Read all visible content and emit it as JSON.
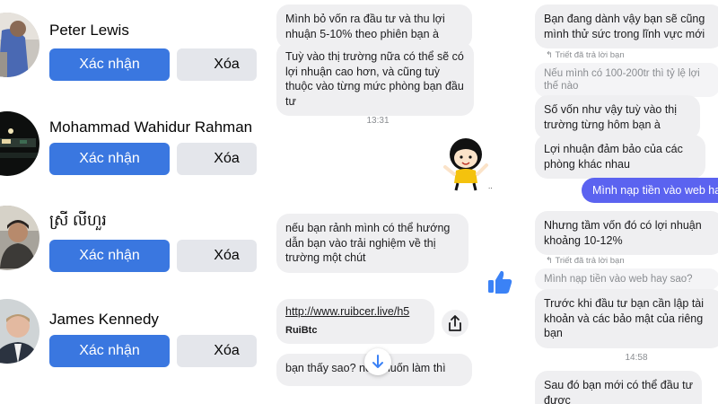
{
  "friend_requests": [
    {
      "name": "Peter Lewis",
      "confirm_label": "Xác nhận",
      "delete_label": "Xóa"
    },
    {
      "name": "Mohammad Wahidur Rahman",
      "confirm_label": "Xác nhận",
      "delete_label": "Xóa"
    },
    {
      "name": "ស្រី លីហួរ",
      "confirm_label": "Xác nhận",
      "delete_label": "Xóa"
    },
    {
      "name": "James Kennedy",
      "confirm_label": "Xác nhận",
      "delete_label": "Xóa"
    }
  ],
  "chat1": {
    "messages": [
      "Mình bỏ vốn ra đầu tư và thu lợi nhuận 5-10% theo phiên bạn à",
      "Tuỳ vào thị trường nữa có thể sẽ có lợi nhuận cao hơn, và cũng tuỳ thuộc vào từng mức phòng bạn đầu tư",
      "nếu bạn rảnh mình có thể hướng dẫn bạn vào trải nghiệm về thị trường một chút",
      "bạn thấy sao? nếu muốn làm thì"
    ],
    "timestamp": "13:31",
    "link": {
      "url": "http://www.ruibcer.live/h5",
      "site_name": "RuiBtc"
    }
  },
  "chat2": {
    "messages_top": [
      "Bạn đang dành vậy bạn sẽ cũng mình thử sức trong lĩnh vực mới"
    ],
    "reply_tag": "Triết đã trả lời bạn",
    "quoted_1": "Nếu mình có 100-200tr thì tỷ lệ lợi thế nào",
    "messages_mid": [
      "Số vốn như vậy tuỳ vào thị trường từng hôm bạn à",
      "Lợi nhuận đảm bảo của các phòng khác nhau"
    ],
    "outgoing": "Mình nạp tiền vào web hay",
    "message_profit": "Nhưng tầm vốn đó có lợi nhuận khoảng 10-12%",
    "quoted_2": "Mình nạp tiền vào web hay sao?",
    "message_before": "Trước khi đầu tư bạn cần lập tài khoản và các bảo mật của riêng bạn",
    "timestamp": "14:58",
    "message_last": "Sau đó bạn mới có thể đầu tư được"
  },
  "colors": {
    "confirm_button": "#3a77e0",
    "delete_button": "#e4e6eb",
    "outgoing_bubble": "#5b63f0",
    "incoming_bubble": "#efeff1",
    "like_icon": "#3b82f6"
  },
  "icons": [
    "share-icon",
    "arrow-down-icon",
    "thumbs-up-icon",
    "reply-arrow-icon",
    "sticker"
  ]
}
